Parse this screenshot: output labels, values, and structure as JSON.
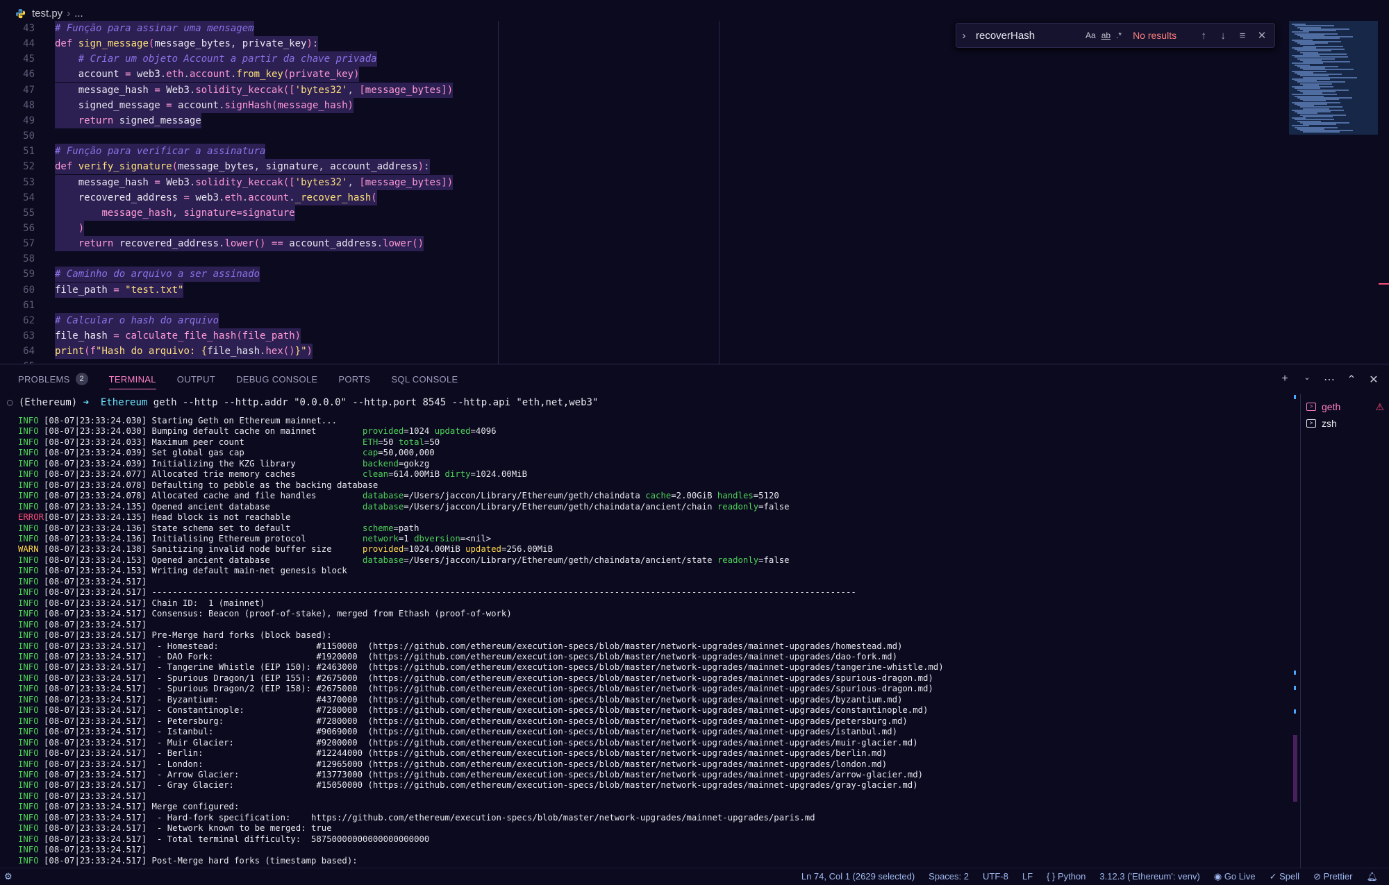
{
  "breadcrumb": {
    "file": "test.py",
    "more": "..."
  },
  "editor": {
    "lines": [
      {
        "n": "43",
        "html": "<span class=\"cm\"># Função para assinar uma mensagem</span>",
        "hl": true
      },
      {
        "n": "44",
        "html": "<span class=\"kw\">def</span> <span class=\"fn\">sign_message</span><span class=\"par\">(</span><span class=\"var\">message_bytes</span>, <span class=\"var\">private_key</span><span class=\"par\">)</span>:",
        "hl": true
      },
      {
        "n": "45",
        "html": "    <span class=\"cm\"># Criar um objeto Account a partir da chave privada</span>",
        "hl": true
      },
      {
        "n": "46",
        "html": "    <span class=\"var\">account</span> <span class=\"op\">=</span> <span class=\"var\">web3</span>.<span class=\"kw\">eth</span>.<span class=\"kw\">account</span>.<span class=\"fn\">from_key</span><span class=\"par\">(</span><span class=\"kw\">private_key</span><span class=\"par\">)</span>",
        "hl": true
      },
      {
        "n": "47",
        "html": "    <span class=\"var\">message_hash</span> <span class=\"op\">=</span> <span class=\"var\">Web3</span>.<span class=\"kw\">solidity_keccak</span><span class=\"par\">([</span><span class=\"str\">'bytes32'</span>, <span class=\"par\">[</span><span class=\"kw\">message_bytes</span><span class=\"par\">])</span>",
        "hl": true
      },
      {
        "n": "48",
        "html": "    <span class=\"var\">signed_message</span> <span class=\"op\">=</span> <span class=\"var\">account</span>.<span class=\"kw\">signHash</span><span class=\"par\">(</span><span class=\"kw\">message_hash</span><span class=\"par\">)</span>",
        "hl": true
      },
      {
        "n": "49",
        "html": "    <span class=\"kw\">return</span> <span class=\"var\">signed_message</span>",
        "hl": true
      },
      {
        "n": "50",
        "html": "",
        "hl": false
      },
      {
        "n": "51",
        "html": "<span class=\"cm\"># Função para verificar a assinatura</span>",
        "hl": true
      },
      {
        "n": "52",
        "html": "<span class=\"kw\">def</span> <span class=\"fn\">verify_signature</span><span class=\"par\">(</span><span class=\"var\">message_bytes</span>, <span class=\"var\">signature</span>, <span class=\"var\">account_address</span><span class=\"par\">)</span>:",
        "hl": true
      },
      {
        "n": "53",
        "html": "    <span class=\"var\">message_hash</span> <span class=\"op\">=</span> <span class=\"var\">Web3</span>.<span class=\"kw\">solidity_keccak</span><span class=\"par\">([</span><span class=\"str\">'bytes32'</span>, <span class=\"par\">[</span><span class=\"kw\">message_bytes</span><span class=\"par\">])</span>",
        "hl": true
      },
      {
        "n": "54",
        "html": "    <span class=\"var\">recovered_address</span> <span class=\"op\">=</span> <span class=\"var\">web3</span>.<span class=\"kw\">eth</span>.<span class=\"kw\">account</span>.<span class=\"fn\">_recover_hash</span><span class=\"par\">(</span>",
        "hl": true
      },
      {
        "n": "55",
        "html": "        <span class=\"kw\">message_hash</span>, <span class=\"kw\">signature</span><span class=\"op\">=</span><span class=\"kw\">signature</span>",
        "hl": true
      },
      {
        "n": "56",
        "html": "    <span class=\"par\">)</span>",
        "hl": true
      },
      {
        "n": "57",
        "html": "    <span class=\"kw\">return</span> <span class=\"var\">recovered_address</span>.<span class=\"kw\">lower</span><span class=\"par\">()</span> <span class=\"op\">==</span> <span class=\"var\">account_address</span>.<span class=\"kw\">lower</span><span class=\"par\">()</span>",
        "hl": true
      },
      {
        "n": "58",
        "html": "",
        "hl": false
      },
      {
        "n": "59",
        "html": "<span class=\"cm\"># Caminho do arquivo a ser assinado</span>",
        "hl": true
      },
      {
        "n": "60",
        "html": "<span class=\"var\">file_path</span> <span class=\"op\">=</span> <span class=\"str\">\"test.txt\"</span>",
        "hl": true
      },
      {
        "n": "61",
        "html": "",
        "hl": false
      },
      {
        "n": "62",
        "html": "<span class=\"cm\"># Calcular o hash do arquivo</span>",
        "hl": true
      },
      {
        "n": "63",
        "html": "<span class=\"var\">file_hash</span> <span class=\"op\">=</span> <span class=\"kw\">calculate_file_hash</span><span class=\"par\">(</span><span class=\"kw\">file_path</span><span class=\"par\">)</span>",
        "hl": true
      },
      {
        "n": "64",
        "html": "<span class=\"fn\">print</span><span class=\"par\">(</span><span class=\"op\">f</span><span class=\"str\">\"Hash do arquivo: {</span><span class=\"var\">file_hash</span>.<span class=\"kw\">hex</span><span class=\"par\">()</span><span class=\"str\">}\"</span><span class=\"par\">)</span>",
        "hl": true
      },
      {
        "n": "65",
        "html": "",
        "hl": false
      }
    ]
  },
  "find": {
    "query": "recoverHash",
    "match_case": "Aa",
    "whole_word": "ab",
    "regex": ".*",
    "result": "No results"
  },
  "panel": {
    "tabs": [
      {
        "label": "PROBLEMS",
        "badge": "2"
      },
      {
        "label": "TERMINAL",
        "active": true
      },
      {
        "label": "OUTPUT"
      },
      {
        "label": "DEBUG CONSOLE"
      },
      {
        "label": "PORTS"
      },
      {
        "label": "SQL CONSOLE"
      }
    ],
    "terminals": [
      {
        "name": "geth",
        "active": true,
        "warning": true
      },
      {
        "name": "zsh"
      }
    ]
  },
  "terminal": {
    "prompt_env": "(Ethereum)",
    "prompt_dir": "Ethereum",
    "command": "geth --http --http.addr \"0.0.0.0\" --http.port 8545 --http.api \"eth,net,web3\"",
    "logs": [
      [
        "INFO",
        "[08-07|23:33:24.030] Starting Geth on Ethereum mainnet..."
      ],
      [
        "INFO",
        "[08-07|23:33:24.030] Bumping default cache on mainnet         <span class=\"k\">provided</span>=1024 <span class=\"k\">updated</span>=4096"
      ],
      [
        "INFO",
        "[08-07|23:33:24.033] Maximum peer count                       <span class=\"k\">ETH</span>=50 <span class=\"k\">total</span>=50"
      ],
      [
        "INFO",
        "[08-07|23:33:24.039] Set global gas cap                       <span class=\"k\">cap</span>=50,000,000"
      ],
      [
        "INFO",
        "[08-07|23:33:24.039] Initializing the KZG library             <span class=\"k\">backend</span>=gokzg"
      ],
      [
        "INFO",
        "[08-07|23:33:24.077] Allocated trie memory caches             <span class=\"k\">clean</span>=614.00MiB <span class=\"k\">dirty</span>=1024.00MiB"
      ],
      [
        "INFO",
        "[08-07|23:33:24.078] Defaulting to pebble as the backing database"
      ],
      [
        "INFO",
        "[08-07|23:33:24.078] Allocated cache and file handles         <span class=\"k\">database</span>=/Users/jaccon/Library/Ethereum/geth/chaindata <span class=\"k\">cache</span>=2.00GiB <span class=\"k\">handles</span>=5120"
      ],
      [
        "INFO",
        "[08-07|23:33:24.135] Opened ancient database                  <span class=\"k\">database</span>=/Users/jaccon/Library/Ethereum/geth/chaindata/ancient/chain <span class=\"k\">readonly</span>=false"
      ],
      [
        "ERROR",
        "[08-07|23:33:24.135] Head block is not reachable"
      ],
      [
        "INFO",
        "[08-07|23:33:24.136] State schema set to default              <span class=\"k\">scheme</span>=path"
      ],
      [
        "INFO",
        "[08-07|23:33:24.136] Initialising Ethereum protocol           <span class=\"k\">network</span>=1 <span class=\"k\">dbversion</span>=&lt;nil&gt;"
      ],
      [
        "WARN",
        "[08-07|23:33:24.138] Sanitizing invalid node buffer size      <span class=\"kw-warn\">provided</span>=1024.00MiB <span class=\"kw-warn\">updated</span>=256.00MiB"
      ],
      [
        "INFO",
        "[08-07|23:33:24.153] Opened ancient database                  <span class=\"k\">database</span>=/Users/jaccon/Library/Ethereum/geth/chaindata/ancient/state <span class=\"k\">readonly</span>=false"
      ],
      [
        "INFO",
        "[08-07|23:33:24.153] Writing default main-net genesis block"
      ],
      [
        "INFO",
        "[08-07|23:33:24.517]"
      ],
      [
        "INFO",
        "[08-07|23:33:24.517] -----------------------------------------------------------------------------------------------------------------------------------------"
      ],
      [
        "INFO",
        "[08-07|23:33:24.517] Chain ID:  1 (mainnet)"
      ],
      [
        "INFO",
        "[08-07|23:33:24.517] Consensus: Beacon (proof-of-stake), merged from Ethash (proof-of-work)"
      ],
      [
        "INFO",
        "[08-07|23:33:24.517]"
      ],
      [
        "INFO",
        "[08-07|23:33:24.517] Pre-Merge hard forks (block based):"
      ],
      [
        "INFO",
        "[08-07|23:33:24.517]  - Homestead:                   #1150000  (https://github.com/ethereum/execution-specs/blob/master/network-upgrades/mainnet-upgrades/homestead.md)"
      ],
      [
        "INFO",
        "[08-07|23:33:24.517]  - DAO Fork:                    #1920000  (https://github.com/ethereum/execution-specs/blob/master/network-upgrades/mainnet-upgrades/dao-fork.md)"
      ],
      [
        "INFO",
        "[08-07|23:33:24.517]  - Tangerine Whistle (EIP 150): #2463000  (https://github.com/ethereum/execution-specs/blob/master/network-upgrades/mainnet-upgrades/tangerine-whistle.md)"
      ],
      [
        "INFO",
        "[08-07|23:33:24.517]  - Spurious Dragon/1 (EIP 155): #2675000  (https://github.com/ethereum/execution-specs/blob/master/network-upgrades/mainnet-upgrades/spurious-dragon.md)"
      ],
      [
        "INFO",
        "[08-07|23:33:24.517]  - Spurious Dragon/2 (EIP 158): #2675000  (https://github.com/ethereum/execution-specs/blob/master/network-upgrades/mainnet-upgrades/spurious-dragon.md)"
      ],
      [
        "INFO",
        "[08-07|23:33:24.517]  - Byzantium:                   #4370000  (https://github.com/ethereum/execution-specs/blob/master/network-upgrades/mainnet-upgrades/byzantium.md)"
      ],
      [
        "INFO",
        "[08-07|23:33:24.517]  - Constantinople:              #7280000  (https://github.com/ethereum/execution-specs/blob/master/network-upgrades/mainnet-upgrades/constantinople.md)"
      ],
      [
        "INFO",
        "[08-07|23:33:24.517]  - Petersburg:                  #7280000  (https://github.com/ethereum/execution-specs/blob/master/network-upgrades/mainnet-upgrades/petersburg.md)"
      ],
      [
        "INFO",
        "[08-07|23:33:24.517]  - Istanbul:                    #9069000  (https://github.com/ethereum/execution-specs/blob/master/network-upgrades/mainnet-upgrades/istanbul.md)"
      ],
      [
        "INFO",
        "[08-07|23:33:24.517]  - Muir Glacier:                #9200000  (https://github.com/ethereum/execution-specs/blob/master/network-upgrades/mainnet-upgrades/muir-glacier.md)"
      ],
      [
        "INFO",
        "[08-07|23:33:24.517]  - Berlin:                      #12244000 (https://github.com/ethereum/execution-specs/blob/master/network-upgrades/mainnet-upgrades/berlin.md)"
      ],
      [
        "INFO",
        "[08-07|23:33:24.517]  - London:                      #12965000 (https://github.com/ethereum/execution-specs/blob/master/network-upgrades/mainnet-upgrades/london.md)"
      ],
      [
        "INFO",
        "[08-07|23:33:24.517]  - Arrow Glacier:               #13773000 (https://github.com/ethereum/execution-specs/blob/master/network-upgrades/mainnet-upgrades/arrow-glacier.md)"
      ],
      [
        "INFO",
        "[08-07|23:33:24.517]  - Gray Glacier:                #15050000 (https://github.com/ethereum/execution-specs/blob/master/network-upgrades/mainnet-upgrades/gray-glacier.md)"
      ],
      [
        "INFO",
        "[08-07|23:33:24.517]"
      ],
      [
        "INFO",
        "[08-07|23:33:24.517] Merge configured:"
      ],
      [
        "INFO",
        "[08-07|23:33:24.517]  - Hard-fork specification:    https://github.com/ethereum/execution-specs/blob/master/network-upgrades/mainnet-upgrades/paris.md"
      ],
      [
        "INFO",
        "[08-07|23:33:24.517]  - Network known to be merged: true"
      ],
      [
        "INFO",
        "[08-07|23:33:24.517]  - Total terminal difficulty:  58750000000000000000000"
      ],
      [
        "INFO",
        "[08-07|23:33:24.517]"
      ],
      [
        "INFO",
        "[08-07|23:33:24.517] Post-Merge hard forks (timestamp based):"
      ]
    ]
  },
  "status": {
    "position": "Ln 74, Col 1 (2629 selected)",
    "spaces": "Spaces: 2",
    "encoding": "UTF-8",
    "eol": "LF",
    "language": "Python",
    "interpreter": "3.12.3 ('Ethereum': venv)",
    "golive": "Go Live",
    "spell": "Spell",
    "prettier": "Prettier"
  },
  "colors": {
    "accent": "#ff7fc8",
    "background": "#0b0a1e",
    "info": "#4fd25a",
    "error": "#ff4f7a",
    "warn": "#ffd84f"
  }
}
